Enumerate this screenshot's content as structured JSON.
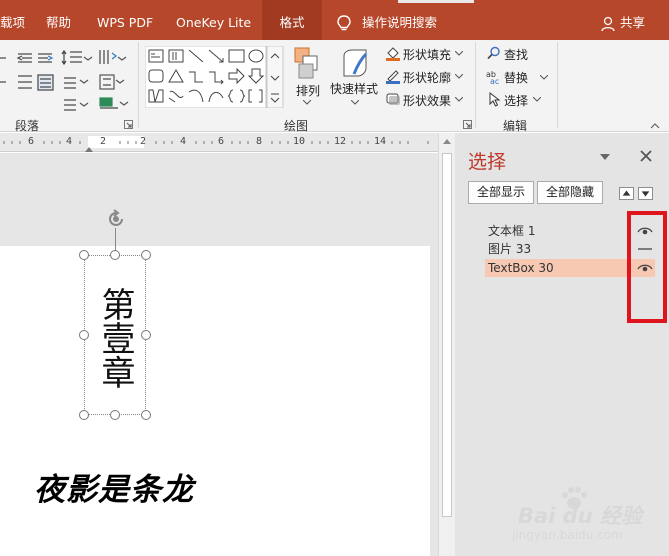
{
  "menubar": {
    "items": [
      {
        "label": "载项"
      },
      {
        "label": "帮助"
      },
      {
        "label": "WPS PDF"
      },
      {
        "label": "OneKey Lite"
      },
      {
        "label": "格式"
      },
      {
        "label": "操作说明搜索"
      }
    ],
    "share_label": "共享",
    "accent_color": "#b7472a"
  },
  "ribbon": {
    "paragraph_group_label": "段落",
    "drawing_group_label": "绘图",
    "editing_group_label": "编辑",
    "arrange_label": "排列",
    "quick_styles_label": "快速样式",
    "shape_fill_label": "形状填充",
    "shape_outline_label": "形状轮廓",
    "shape_effects_label": "形状效果",
    "find_label": "查找",
    "replace_label": "替换",
    "select_label": "选择"
  },
  "ruler": {
    "numbers": [
      "6",
      "4",
      "2",
      "2",
      "4",
      "6",
      "8",
      "10",
      "12",
      "14"
    ]
  },
  "document": {
    "textbox_text": "第壹章",
    "subtitle_text": "夜影是条龙"
  },
  "selection_pane": {
    "title": "选择",
    "show_all_label": "全部显示",
    "hide_all_label": "全部隐藏",
    "items": [
      {
        "label": "文本框 1",
        "visibility": "visible-eye-icon",
        "selected": false
      },
      {
        "label": "图片 33",
        "visibility": "hidden-dash-icon",
        "selected": false
      },
      {
        "label": "TextBox 30",
        "visibility": "visible-eye-icon",
        "selected": true
      }
    ],
    "highlight_color": "#e0141c"
  },
  "watermark": {
    "line1": "Bai du 经验",
    "line2": "jingyan.baidu.com"
  }
}
